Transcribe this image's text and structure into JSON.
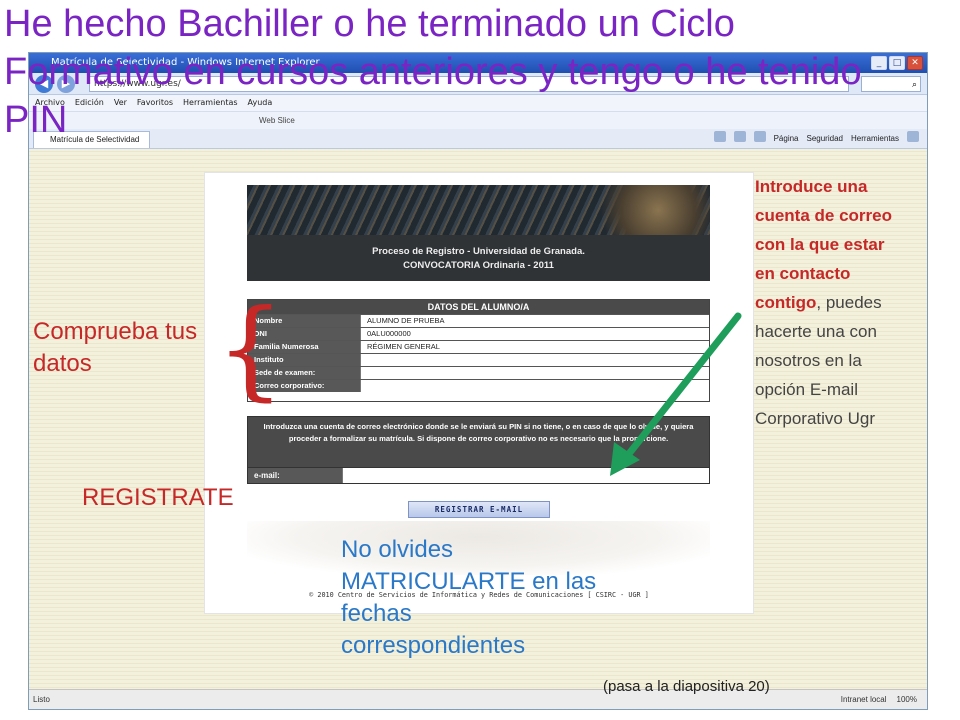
{
  "slide": {
    "title": "He hecho Bachiller o he terminado un Ciclo Formativo en cursos anteriores y tengo o he tenido PIN",
    "check_label": "Comprueba tus datos",
    "brace": "{",
    "register_label": "REGISTRATE",
    "matriculate_note": "No olvides MATRICULARTE en las fechas correspondientes",
    "side_note_strong_lead": "Introduce una cuenta de correo con la que estar en contacto ",
    "side_note_strong_end": "contigo",
    "side_note_rest": ", puedes hacerte una con nosotros en la opción E-mail Corporativo Ugr",
    "next_slide": "(pasa a la diapositiva 20)",
    "colors": {
      "title": "#7b24c4",
      "red": "#c62828",
      "blue": "#2a78c8",
      "arrow": "#1e9e5a"
    }
  },
  "browser": {
    "window_title": "Matrícula de Selectividad - Windows Internet Explorer",
    "address": "https://www.ugr.es/",
    "menus": [
      "Archivo",
      "Edición",
      "Ver",
      "Favoritos",
      "Herramientas",
      "Ayuda"
    ],
    "fav_web_slice": "Web Slice",
    "tab_label": "Matrícula de Selectividad",
    "commands": [
      "Página",
      "Seguridad",
      "Herramientas"
    ],
    "status_left": "Listo",
    "status_zone": "Intranet local",
    "zoom": "100%",
    "icons": [
      "back-arrow-icon",
      "forward-arrow-icon",
      "home-icon",
      "rss-icon",
      "print-icon",
      "help-icon"
    ]
  },
  "page": {
    "banner_title": "Proceso de Registro - Universidad de Granada.",
    "banner_subtitle": "CONVOCATORIA Ordinaria - 2011",
    "student_header": "DATOS DEL ALUMNO/A",
    "student_rows": [
      {
        "label": "Nombre",
        "value": "ALUMNO DE PRUEBA"
      },
      {
        "label": "DNI",
        "value": "0ALU000000"
      },
      {
        "label": "Familia Numerosa",
        "value": "RÉGIMEN GENERAL"
      },
      {
        "label": "Instituto",
        "value": ""
      },
      {
        "label": "Sede de examen:",
        "value": ""
      },
      {
        "label": "Correo corporativo:",
        "value": ""
      }
    ],
    "email_text": "Introduzca una cuenta de correo electrónico donde se le enviará su PIN si no tiene, o en caso de que lo olvide, y quiera proceder a formalizar su matrícula. Si dispone de correo corporativo no es necesario que la proporcione.",
    "email_label": "e-mail:",
    "email_value": "",
    "register_button": "REGISTRAR E-MAIL",
    "footer": "© 2010 Centro de Servicios de Informática y Redes de Comunicaciones [ CSIRC - UGR ]"
  }
}
